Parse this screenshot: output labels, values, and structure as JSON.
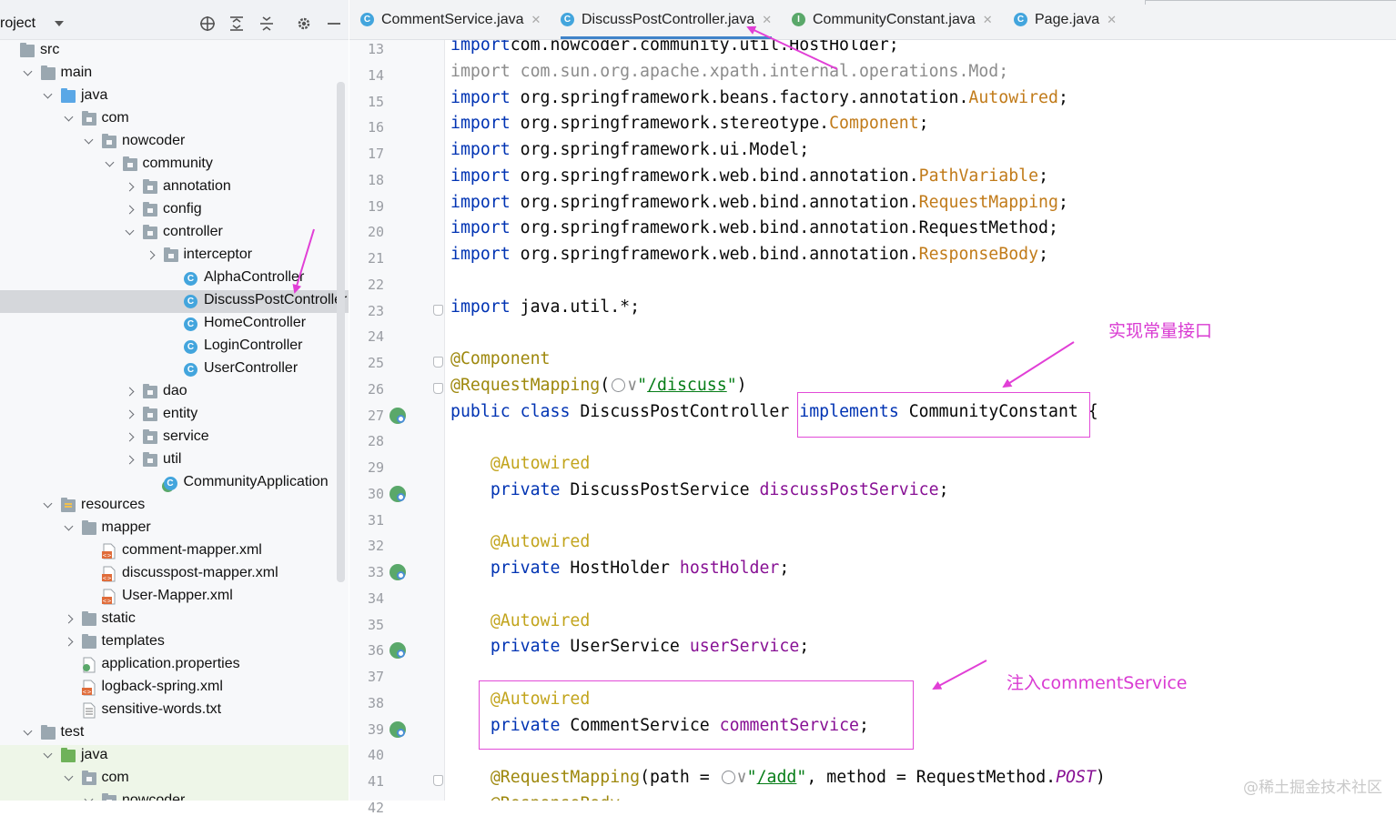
{
  "project": {
    "title": "roject",
    "tree": [
      {
        "label": "src",
        "indent": 0,
        "arrow": "none",
        "icon": "folder"
      },
      {
        "label": "main",
        "indent": 1,
        "arrow": "down",
        "icon": "folder"
      },
      {
        "label": "java",
        "indent": 2,
        "arrow": "down",
        "icon": "folder-src"
      },
      {
        "label": "com",
        "indent": 3,
        "arrow": "down",
        "icon": "package"
      },
      {
        "label": "nowcoder",
        "indent": 4,
        "arrow": "down",
        "icon": "package"
      },
      {
        "label": "community",
        "indent": 5,
        "arrow": "down",
        "icon": "package"
      },
      {
        "label": "annotation",
        "indent": 6,
        "arrow": "right",
        "icon": "package"
      },
      {
        "label": "config",
        "indent": 6,
        "arrow": "right",
        "icon": "package"
      },
      {
        "label": "controller",
        "indent": 6,
        "arrow": "down",
        "icon": "package"
      },
      {
        "label": "interceptor",
        "indent": 7,
        "arrow": "right",
        "icon": "package"
      },
      {
        "label": "AlphaController",
        "indent": 8,
        "arrow": "none",
        "icon": "class"
      },
      {
        "label": "DiscussPostController",
        "indent": 8,
        "arrow": "none",
        "icon": "class",
        "selected": true
      },
      {
        "label": "HomeController",
        "indent": 8,
        "arrow": "none",
        "icon": "class"
      },
      {
        "label": "LoginController",
        "indent": 8,
        "arrow": "none",
        "icon": "class"
      },
      {
        "label": "UserController",
        "indent": 8,
        "arrow": "none",
        "icon": "class"
      },
      {
        "label": "dao",
        "indent": 6,
        "arrow": "right",
        "icon": "package"
      },
      {
        "label": "entity",
        "indent": 6,
        "arrow": "right",
        "icon": "package"
      },
      {
        "label": "service",
        "indent": 6,
        "arrow": "right",
        "icon": "package"
      },
      {
        "label": "util",
        "indent": 6,
        "arrow": "right",
        "icon": "package"
      },
      {
        "label": "CommunityApplication",
        "indent": 7,
        "arrow": "none",
        "icon": "app-class"
      },
      {
        "label": "resources",
        "indent": 2,
        "arrow": "down",
        "icon": "folder-res"
      },
      {
        "label": "mapper",
        "indent": 3,
        "arrow": "down",
        "icon": "folder"
      },
      {
        "label": "comment-mapper.xml",
        "indent": 4,
        "arrow": "none",
        "icon": "xml-file"
      },
      {
        "label": "discusspost-mapper.xml",
        "indent": 4,
        "arrow": "none",
        "icon": "xml-file"
      },
      {
        "label": "User-Mapper.xml",
        "indent": 4,
        "arrow": "none",
        "icon": "xml-file"
      },
      {
        "label": "static",
        "indent": 3,
        "arrow": "right",
        "icon": "folder"
      },
      {
        "label": "templates",
        "indent": 3,
        "arrow": "right",
        "icon": "folder"
      },
      {
        "label": "application.properties",
        "indent": 3,
        "arrow": "none",
        "icon": "properties-file"
      },
      {
        "label": "logback-spring.xml",
        "indent": 3,
        "arrow": "none",
        "icon": "xml-file"
      },
      {
        "label": "sensitive-words.txt",
        "indent": 3,
        "arrow": "none",
        "icon": "text-file"
      },
      {
        "label": "test",
        "indent": 1,
        "arrow": "down",
        "icon": "folder"
      },
      {
        "label": "java",
        "indent": 2,
        "arrow": "down",
        "icon": "folder-test",
        "green": true
      },
      {
        "label": "com",
        "indent": 3,
        "arrow": "down",
        "icon": "package",
        "green": true
      },
      {
        "label": "nowcoder",
        "indent": 4,
        "arrow": "down",
        "icon": "package",
        "green": true
      }
    ]
  },
  "tabs": [
    {
      "label": "CommentService.java",
      "icon": "class",
      "icon_letter": "C",
      "color": "#43a5dd",
      "active": false
    },
    {
      "label": "DiscussPostController.java",
      "icon": "class",
      "icon_letter": "C",
      "color": "#43a5dd",
      "active": true
    },
    {
      "label": "CommunityConstant.java",
      "icon": "interface",
      "icon_letter": "I",
      "color": "#5aa86a",
      "active": false
    },
    {
      "label": "Page.java",
      "icon": "class",
      "icon_letter": "C",
      "color": "#43a5dd",
      "active": false
    }
  ],
  "editor": {
    "gutter_markers": [
      27,
      30,
      33,
      36,
      39
    ],
    "fold_markers": [
      23,
      25,
      26,
      41
    ],
    "lines": [
      {
        "n": "13",
        "tokens": [
          [
            "kw",
            "import"
          ],
          [
            "",
            "com.nowcoder.community.util.HostHolder;"
          ]
        ]
      },
      {
        "n": "14",
        "tokens": [
          [
            "dim",
            "import com.sun.org.apache.xpath.internal.operations.Mod;"
          ]
        ]
      },
      {
        "n": "15",
        "tokens": [
          [
            "kw",
            "import"
          ],
          [
            "",
            " org.springframework.beans.factory.annotation."
          ],
          [
            "imp",
            "Autowired"
          ],
          [
            "",
            ";"
          ]
        ]
      },
      {
        "n": "16",
        "tokens": [
          [
            "kw",
            "import"
          ],
          [
            "",
            " org.springframework.stereotype."
          ],
          [
            "imp",
            "Component"
          ],
          [
            "",
            ";"
          ]
        ]
      },
      {
        "n": "17",
        "tokens": [
          [
            "kw",
            "import"
          ],
          [
            "",
            " org.springframework.ui.Model;"
          ]
        ]
      },
      {
        "n": "18",
        "tokens": [
          [
            "kw",
            "import"
          ],
          [
            "",
            " org.springframework.web.bind.annotation."
          ],
          [
            "imp",
            "PathVariable"
          ],
          [
            "",
            ";"
          ]
        ]
      },
      {
        "n": "19",
        "tokens": [
          [
            "kw",
            "import"
          ],
          [
            "",
            " org.springframework.web.bind.annotation."
          ],
          [
            "imp",
            "RequestMapping"
          ],
          [
            "",
            ";"
          ]
        ]
      },
      {
        "n": "20",
        "tokens": [
          [
            "kw",
            "import"
          ],
          [
            "",
            " org.springframework.web.bind.annotation.RequestMethod;"
          ]
        ]
      },
      {
        "n": "21",
        "tokens": [
          [
            "kw",
            "import"
          ],
          [
            "",
            " org.springframework.web.bind.annotation."
          ],
          [
            "imp",
            "ResponseBody"
          ],
          [
            "",
            ";"
          ]
        ]
      },
      {
        "n": "22",
        "tokens": []
      },
      {
        "n": "23",
        "tokens": [
          [
            "kw",
            "import"
          ],
          [
            "",
            " java.util.*;"
          ]
        ]
      },
      {
        "n": "24",
        "tokens": []
      },
      {
        "n": "25",
        "tokens": [
          [
            "ann",
            "@Component"
          ]
        ]
      },
      {
        "n": "26",
        "tokens": [
          [
            "ann",
            "@RequestMapping"
          ],
          [
            "",
            "("
          ],
          [
            "globe",
            ""
          ],
          [
            "dim",
            "∨"
          ],
          [
            "str",
            "\""
          ],
          [
            "url",
            "/discuss"
          ],
          [
            "str",
            "\""
          ],
          [
            "",
            ")"
          ]
        ]
      },
      {
        "n": "27",
        "tokens": [
          [
            "kw",
            "public class"
          ],
          [
            "",
            " DiscussPostController "
          ],
          [
            "kw",
            "implements"
          ],
          [
            "",
            " CommunityConstant {"
          ]
        ]
      },
      {
        "n": "28",
        "tokens": []
      },
      {
        "n": "29",
        "tokens": [
          [
            "",
            "    "
          ],
          [
            "annr",
            "@Autowired"
          ]
        ]
      },
      {
        "n": "30",
        "tokens": [
          [
            "",
            "    "
          ],
          [
            "kw",
            "private"
          ],
          [
            "",
            " DiscussPostService "
          ],
          [
            "fld",
            "discussPostService"
          ],
          [
            "",
            ";"
          ]
        ]
      },
      {
        "n": "31",
        "tokens": []
      },
      {
        "n": "32",
        "tokens": [
          [
            "",
            "    "
          ],
          [
            "annr",
            "@Autowired"
          ]
        ]
      },
      {
        "n": "33",
        "tokens": [
          [
            "",
            "    "
          ],
          [
            "kw",
            "private"
          ],
          [
            "",
            " HostHolder "
          ],
          [
            "fld",
            "hostHolder"
          ],
          [
            "",
            ";"
          ]
        ]
      },
      {
        "n": "34",
        "tokens": []
      },
      {
        "n": "35",
        "tokens": [
          [
            "",
            "    "
          ],
          [
            "annr",
            "@Autowired"
          ]
        ]
      },
      {
        "n": "36",
        "tokens": [
          [
            "",
            "    "
          ],
          [
            "kw",
            "private"
          ],
          [
            "",
            " UserService "
          ],
          [
            "fld",
            "userService"
          ],
          [
            "",
            ";"
          ]
        ]
      },
      {
        "n": "37",
        "tokens": []
      },
      {
        "n": "38",
        "tokens": [
          [
            "",
            "    "
          ],
          [
            "annr",
            "@Autowired"
          ]
        ]
      },
      {
        "n": "39",
        "tokens": [
          [
            "",
            "    "
          ],
          [
            "kw",
            "private"
          ],
          [
            "",
            " CommentService "
          ],
          [
            "fld",
            "commentService"
          ],
          [
            "",
            ";"
          ]
        ]
      },
      {
        "n": "40",
        "tokens": []
      },
      {
        "n": "41",
        "tokens": [
          [
            "",
            "    "
          ],
          [
            "ann",
            "@RequestMapping"
          ],
          [
            "",
            "(path = "
          ],
          [
            "globe",
            ""
          ],
          [
            "dim",
            "∨"
          ],
          [
            "str",
            "\""
          ],
          [
            "url",
            "/add"
          ],
          [
            "str",
            "\""
          ],
          [
            "",
            ", method = RequestMethod."
          ],
          [
            "ital",
            "POST"
          ],
          [
            "",
            ")"
          ]
        ]
      },
      {
        "n": "42",
        "tokens": [
          [
            "",
            "    "
          ],
          [
            "ann",
            "@ResponseBody"
          ]
        ]
      }
    ]
  },
  "annotations": {
    "implements_note": "实现常量接口",
    "inject_note": "注入commentService"
  },
  "watermark": "@稀土掘金技术社区"
}
